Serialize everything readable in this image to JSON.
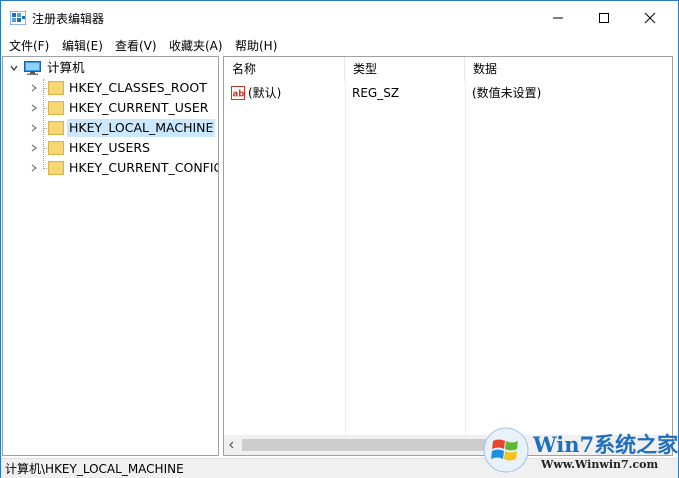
{
  "window": {
    "title": "注册表编辑器"
  },
  "menu": {
    "items": [
      "文件(F)",
      "编辑(E)",
      "查看(V)",
      "收藏夹(A)",
      "帮助(H)"
    ]
  },
  "tree": {
    "root": "计算机",
    "items": [
      {
        "label": "HKEY_CLASSES_ROOT",
        "selected": false
      },
      {
        "label": "HKEY_CURRENT_USER",
        "selected": false
      },
      {
        "label": "HKEY_LOCAL_MACHINE",
        "selected": true
      },
      {
        "label": "HKEY_USERS",
        "selected": false
      },
      {
        "label": "HKEY_CURRENT_CONFIG",
        "selected": false
      }
    ]
  },
  "list": {
    "columns": [
      "名称",
      "类型",
      "数据"
    ],
    "rows": [
      {
        "name": "(默认)",
        "type": "REG_SZ",
        "data": "(数值未设置)",
        "icon": "string-value-icon"
      }
    ]
  },
  "status": {
    "path": "计算机\\HKEY_LOCAL_MACHINE"
  },
  "watermark": {
    "brand": "Win7系统之家",
    "url": "Www.Winwin7.com"
  },
  "colors": {
    "selection": "#cce8ff",
    "folder": "#f7d774",
    "accent": "#2b78c7",
    "watermark_blue": "#1f6fc0"
  }
}
